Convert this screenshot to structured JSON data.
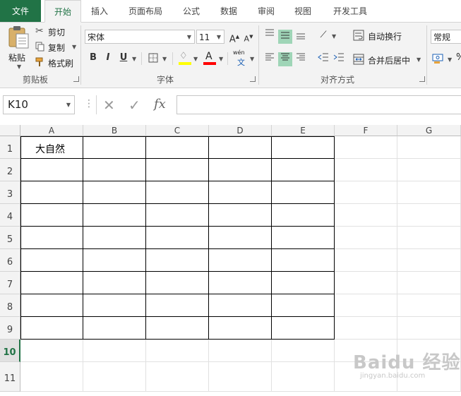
{
  "ribbon_tabs": [
    "文件",
    "开始",
    "插入",
    "页面布局",
    "公式",
    "数据",
    "审阅",
    "视图",
    "开发工具"
  ],
  "clipboard": {
    "paste": "粘贴",
    "cut": "剪切",
    "copy": "复制",
    "format_painter": "格式刷",
    "group_label": "剪贴板"
  },
  "font": {
    "name": "宋体",
    "size": "11",
    "group_label": "字体",
    "bold": "B",
    "italic": "I",
    "underline": "U",
    "phonetic": "wén",
    "phonetic_char": "文",
    "fill_color": "#ffff00",
    "font_color": "#ff0000"
  },
  "alignment": {
    "wrap_text": "自动换行",
    "merge_center": "合并后居中",
    "group_label": "对齐方式"
  },
  "number": {
    "format": "常规"
  },
  "formula_bar": {
    "name_box": "K10",
    "formula": ""
  },
  "sheet": {
    "columns": [
      "A",
      "B",
      "C",
      "D",
      "E",
      "F",
      "G"
    ],
    "rows": [
      "1",
      "2",
      "3",
      "4",
      "5",
      "6",
      "7",
      "8",
      "9",
      "10",
      "11"
    ],
    "selected_row": "10",
    "cells": [
      {
        "ref": "A1",
        "value": "大自然"
      }
    ]
  },
  "accent_color": "#217346",
  "watermark": "Baidu 经验",
  "watermark_sub": "jingyan.baidu.com"
}
